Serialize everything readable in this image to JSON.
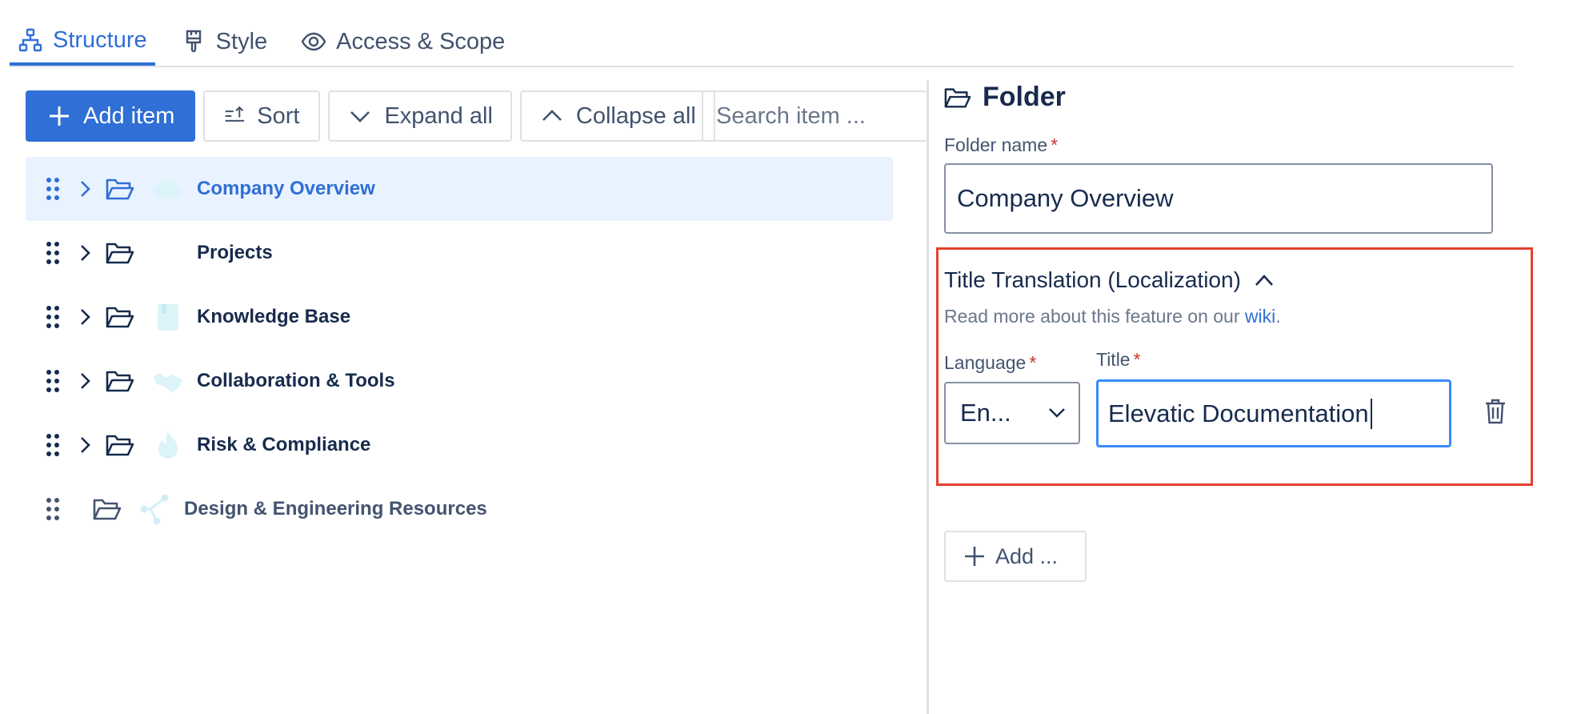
{
  "tabs": [
    {
      "label": "Structure",
      "icon": "hierarchy-icon",
      "active": true
    },
    {
      "label": "Style",
      "icon": "paintbrush-icon",
      "active": false
    },
    {
      "label": "Access & Scope",
      "icon": "eye-icon",
      "active": false
    }
  ],
  "toolbar": {
    "add_item": "Add item",
    "sort": "Sort",
    "expand_all": "Expand all",
    "collapse_all": "Collapse all",
    "search_placeholder": "Search item ..."
  },
  "tree": {
    "items": [
      {
        "label": "Company Overview",
        "icon": "cloud-icon",
        "selected": true,
        "expandable": true
      },
      {
        "label": "Projects",
        "icon": "",
        "selected": false,
        "expandable": true
      },
      {
        "label": "Knowledge Base",
        "icon": "book-icon",
        "selected": false,
        "expandable": true
      },
      {
        "label": "Collaboration & Tools",
        "icon": "handshake-icon",
        "selected": false,
        "expandable": true
      },
      {
        "label": "Risk & Compliance",
        "icon": "flame-icon",
        "selected": false,
        "expandable": true
      },
      {
        "label": "Design & Engineering Resources",
        "icon": "network-icon",
        "selected": false,
        "expandable": false
      }
    ]
  },
  "panel": {
    "title": "Folder",
    "folder_name_label": "Folder name",
    "required_mark": "*",
    "folder_name_value": "Company Overview",
    "translation": {
      "title": "Title Translation (Localization)",
      "desc_prefix": "Read more about this feature on our ",
      "desc_link": "wiki",
      "desc_suffix": ".",
      "language_label": "Language",
      "language_value": "En...",
      "title_label": "Title",
      "title_value": "Elevatic Documentation"
    },
    "add_label": "Add ..."
  },
  "colors": {
    "accent": "#2f6fd6",
    "selected_bg": "#e9f2ff",
    "highlight_border": "#e5402f",
    "focus_border": "#388bff"
  }
}
